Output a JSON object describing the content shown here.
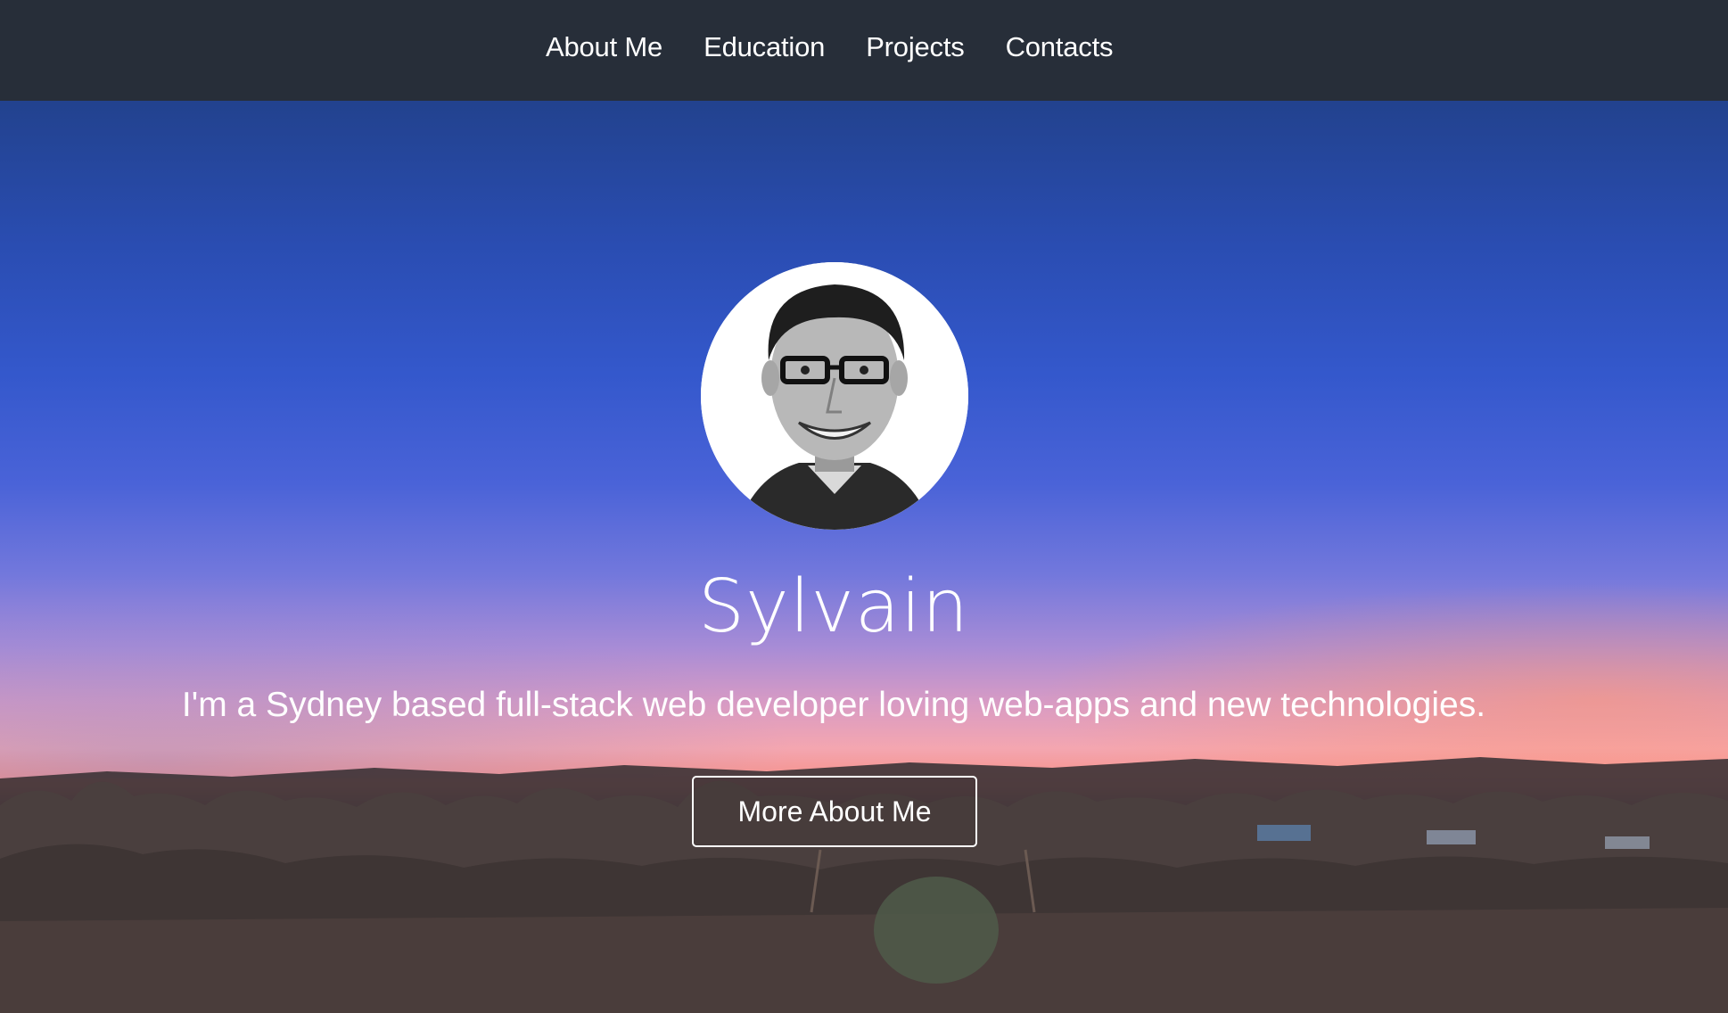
{
  "nav": {
    "items": [
      {
        "label": "About Me"
      },
      {
        "label": "Education"
      },
      {
        "label": "Projects"
      },
      {
        "label": "Contacts"
      }
    ]
  },
  "hero": {
    "name": "Sylvain",
    "tagline": "I'm a Sydney based full-stack web developer loving web-apps and new technologies.",
    "cta_label": "More About Me",
    "avatar_icon": "person-portrait-icon"
  },
  "colors": {
    "navbar": "#272e39",
    "sky_top": "#22428e",
    "sunset": "#f68f86",
    "text": "#ffffff"
  }
}
